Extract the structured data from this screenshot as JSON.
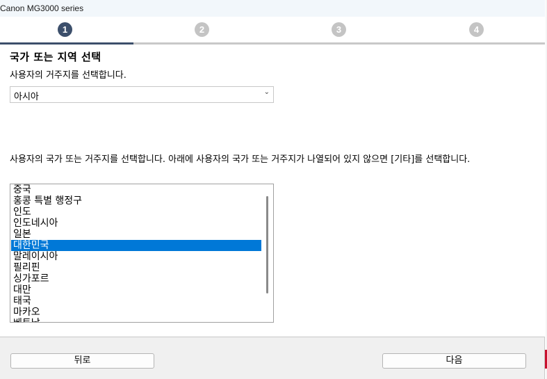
{
  "window": {
    "title": "Canon MG3000 series"
  },
  "steps": [
    {
      "number": "1",
      "active": true
    },
    {
      "number": "2",
      "active": false
    },
    {
      "number": "3",
      "active": false
    },
    {
      "number": "4",
      "active": false
    }
  ],
  "step_progress": 0.245,
  "main": {
    "heading": "국가 또는 지역 선택",
    "subheading": "사용자의 거주지를 선택합니다.",
    "region_select": {
      "value": "아시아"
    },
    "instruction": "사용자의 국가 또는 거주지를 선택합니다. 아래에 사용자의 국가 또는 거주지가 나열되어 있지 않으면 [기타]를 선택합니다.",
    "countries": [
      "중국",
      "홍콩 특별 행정구",
      "인도",
      "인도네시아",
      "일본",
      "대한민국",
      "말레이시아",
      "필리핀",
      "싱가포르",
      "대만",
      "태국",
      "마카오",
      "베트남"
    ],
    "selected_index": 5
  },
  "footer": {
    "back_label": "뒤로",
    "next_label": "다음"
  },
  "colors": {
    "accent": "#3c4f6b",
    "selection": "#0078d7",
    "inactive_step": "#c4c4c4"
  }
}
